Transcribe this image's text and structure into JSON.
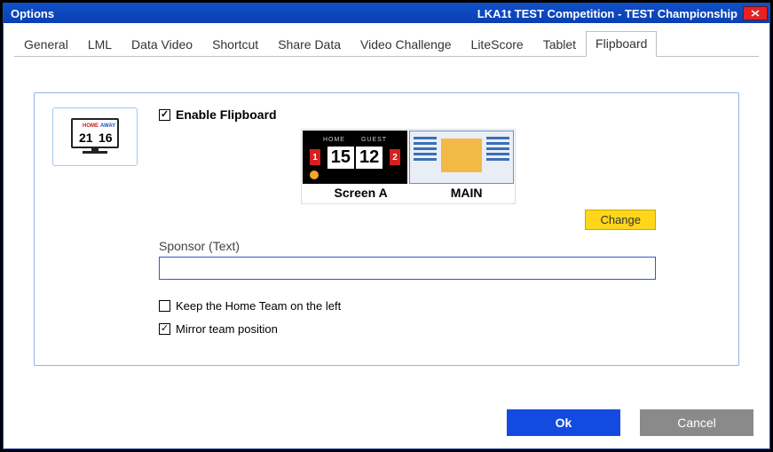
{
  "window": {
    "title_left": "Options",
    "title_right": "LKA1t  TEST Competition - TEST Championship"
  },
  "tabs": [
    {
      "label": "General"
    },
    {
      "label": "LML"
    },
    {
      "label": "Data Video"
    },
    {
      "label": "Shortcut"
    },
    {
      "label": "Share Data"
    },
    {
      "label": "Video Challenge"
    },
    {
      "label": "LiteScore"
    },
    {
      "label": "Tablet"
    },
    {
      "label": "Flipboard"
    }
  ],
  "active_tab": "Flipboard",
  "flipboard": {
    "enable_label": "Enable Flipboard",
    "enable_checked": true,
    "previews": {
      "screen_a": {
        "label": "Screen A",
        "home_label": "HOME",
        "guest_label": "GUEST",
        "score_left": "15",
        "score_right": "12",
        "left_rank": "1",
        "right_rank": "2"
      },
      "main": {
        "label": "MAIN"
      }
    },
    "change_button": "Change",
    "sponsor_label": "Sponsor (Text)",
    "sponsor_value": "",
    "keep_home_left": {
      "label": "Keep the Home Team on the left",
      "checked": false
    },
    "mirror_team": {
      "label": "Mirror team position",
      "checked": true
    },
    "preview_icon": {
      "home": "HOME",
      "away": "AWAY",
      "score_l": "21",
      "score_r": "16"
    }
  },
  "buttons": {
    "ok": "Ok",
    "cancel": "Cancel"
  }
}
